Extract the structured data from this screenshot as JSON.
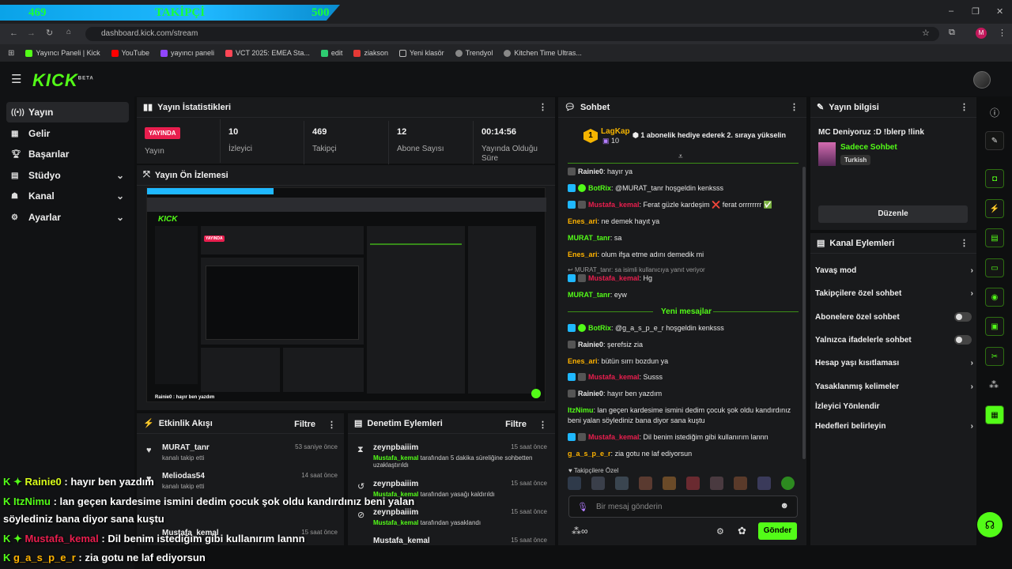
{
  "goal_bar": {
    "current": "469",
    "label": "TAKİPÇİ",
    "target": "500"
  },
  "browser": {
    "url": "dashboard.kick.com/stream",
    "window_controls": [
      "–",
      "❐",
      "✕"
    ],
    "bookmarks": [
      "Yayıncı Paneli | Kick",
      "YouTube",
      "yayıncı paneli",
      "VCT 2025: EMEA Sta...",
      "edit",
      "ziakson",
      "Yeni klasör",
      "Trendyol",
      "Kitchen Time Ultras..."
    ]
  },
  "kick": {
    "logo": "KICK",
    "beta": "BETA"
  },
  "sidebar": {
    "items": [
      {
        "label": "Yayın",
        "icon": "broadcast-icon"
      },
      {
        "label": "Gelir",
        "icon": "grid-icon"
      },
      {
        "label": "Başarılar",
        "icon": "trophy-icon"
      },
      {
        "label": "Stüdyo",
        "icon": "studio-icon"
      },
      {
        "label": "Kanal",
        "icon": "channel-icon"
      },
      {
        "label": "Ayarlar",
        "icon": "settings-icon"
      }
    ]
  },
  "stats": {
    "title": "Yayın İstatistikleri",
    "status_badge": "YAYINDA",
    "status_label": "Yayın",
    "viewers": {
      "value": "10",
      "label": "İzleyici"
    },
    "followers": {
      "value": "469",
      "label": "Takipçi"
    },
    "subs": {
      "value": "12",
      "label": "Abone Sayısı"
    },
    "uptime": {
      "value": "00:14:56",
      "label": "Yayında Olduğu Süre"
    }
  },
  "preview": {
    "title": "Yayın Ön İzlemesi",
    "caption": "Rainie0 : hayır ben yazdım"
  },
  "activity": {
    "title": "Etkinlik Akışı",
    "filter": "Filtre",
    "items": [
      {
        "name": "MURAT_tanr",
        "sub": "kanalı takip etti",
        "time": "53 saniye önce"
      },
      {
        "name": "Meliodas54",
        "sub": "kanalı takip etti",
        "time": "14 saat önce"
      },
      {
        "name": "Mustafa_kemal",
        "sub": "",
        "time": "15 saat önce"
      }
    ]
  },
  "moderation": {
    "title": "Denetim Eylemleri",
    "filter": "Filtre",
    "items": [
      {
        "name": "zeynpbaiiim",
        "actor": "Mustafa_kemal",
        "text": "tarafından 5 dakika süreliğine sohbetten uzaklaştırıldı",
        "time": "15 saat önce"
      },
      {
        "name": "zeynpbaiiim",
        "actor": "Mustafa_kemal",
        "text": "tarafından yasağı kaldırıldı",
        "time": "15 saat önce"
      },
      {
        "name": "zeynpbaiiim",
        "actor": "Mustafa_kemal",
        "text": "tarafından yasaklandı",
        "time": "15 saat önce"
      },
      {
        "name": "Mustafa_kemal",
        "actor": "",
        "text": "",
        "time": "15 saat önce"
      }
    ]
  },
  "chat": {
    "title": "Sohbet",
    "pinned_user": "LagKap",
    "pinned_count": "10",
    "pinned_text": "1 abonelik hediye ederek 2. sıraya yükselin",
    "messages": [
      {
        "user": "Rainie0",
        "color": "#e6e6e6",
        "text": "hayır ya"
      },
      {
        "user": "BotRix",
        "color": "#53fc18",
        "text": "@MURAT_tanr hoşgeldin kenksss"
      },
      {
        "user": "Mustafa_kemal",
        "color": "#e91e4e",
        "text": "Ferat güzle kardeşim ❌ ferat orrrrrrrr ✅"
      },
      {
        "user": "Enes_ari",
        "color": "#ffb300",
        "text": "ne demek hayıt ya"
      },
      {
        "user": "MURAT_tanr",
        "color": "#53fc18",
        "text": "sa"
      },
      {
        "user": "Enes_ari",
        "color": "#ffb300",
        "text": "olum ifşa etme adını demedik mi"
      },
      {
        "user": "Mustafa_kemal",
        "color": "#e91e4e",
        "text": "Hg"
      },
      {
        "user": "MURAT_tanr",
        "color": "#53fc18",
        "text": "eyw"
      },
      {
        "user": "BotRix",
        "color": "#53fc18",
        "text": "@g_a_s_p_e_r hoşgeldin kenksss"
      },
      {
        "user": "Rainie0",
        "color": "#e6e6e6",
        "text": "şerefsiz zia"
      },
      {
        "user": "Enes_ari",
        "color": "#ffb300",
        "text": "bütün sırrı bozdun ya"
      },
      {
        "user": "Mustafa_kemal",
        "color": "#e91e4e",
        "text": "Susss"
      },
      {
        "user": "Rainie0",
        "color": "#e6e6e6",
        "text": "hayır ben yazdım"
      },
      {
        "user": "ItzNimu",
        "color": "#53fc18",
        "text": "lan geçen kardesime ismini dedim çocuk şok oldu kandırdınız beni yalan söylediniz bana diyor sana kuştu"
      },
      {
        "user": "Mustafa_kemal",
        "color": "#e91e4e",
        "text": "Dil benim istediğim gibi kullanırım lannn"
      },
      {
        "user": "g_a_s_p_e_r",
        "color": "#ffb300",
        "text": "zia gotu ne laf ediyorsun"
      }
    ],
    "reply_hint": "MURAT_tanr: sa isimli kullanıcıya yanıt veriyor",
    "new_messages": "Yeni mesajlar",
    "followers_only": "Takipçilere Özel",
    "input_placeholder": "Bir mesaj gönderin",
    "send": "Gönder"
  },
  "stream_info": {
    "title": "Yayın bilgisi",
    "stream_title": "MC Deniyoruz :D !blerp !link",
    "category": "Sadece Sohbet",
    "language": "Turkish",
    "edit": "Düzenle"
  },
  "channel_actions": {
    "title": "Kanal Eylemleri",
    "items": [
      "Yavaş mod",
      "Takipçilere özel sohbet",
      "Abonelere özel sohbet",
      "Yalnızca ifadelerle sohbet",
      "Hesap yaşı kısıtlaması",
      "Yasaklanmış kelimeler",
      "İzleyici Yönlendir",
      "Hedefleri belirleyin"
    ]
  },
  "overlay": {
    "lines": [
      {
        "user": "Rainie0",
        "text": ": hayır ben yazdım"
      },
      {
        "user": "ItzNimu",
        "text": ": lan geçen kardesime ismini dedim çocuk şok oldu kandırdınız beni yalan"
      },
      {
        "user": "",
        "text": "söylediniz bana diyor sana kuştu"
      },
      {
        "user": "Mustafa_kemal",
        "text": ": Dil benim istediğim gibi kullanırım lannn"
      },
      {
        "user": "g_a_s_p_e_r",
        "text": ": zia gotu ne laf ediyorsun"
      }
    ]
  },
  "colors": {
    "accent": "#53fc18",
    "live": "#e91e4e",
    "goal": "#1fb8ff"
  }
}
